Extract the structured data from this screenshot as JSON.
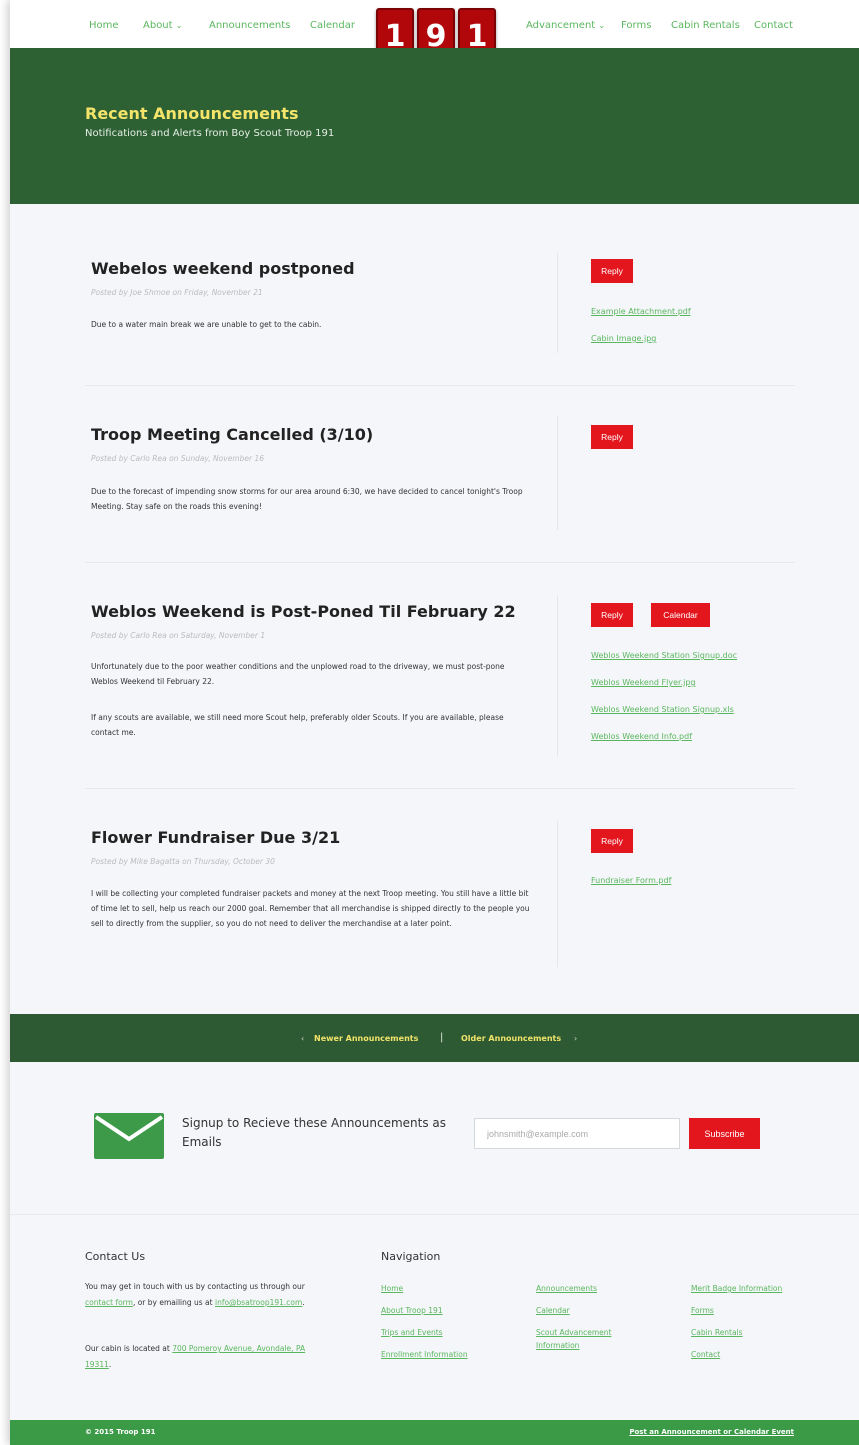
{
  "nav": {
    "home": "Home",
    "about": "About",
    "announcements": "Announcements",
    "calendar": "Calendar",
    "advancement": "Advancement",
    "forms": "Forms",
    "cabin_rentals": "Cabin Rentals",
    "contact": "Contact",
    "logo_digits": [
      "1",
      "9",
      "1"
    ]
  },
  "hero": {
    "title": "Recent Announcements",
    "subtitle": "Notifications and Alerts from Boy Scout Troop 191"
  },
  "posts": [
    {
      "title": "Webelos weekend postponed",
      "meta": "Posted by Joe Shmoe on Friday, November 21",
      "body": "Due to a water main break we are unable to get to the cabin.",
      "reply": "Reply",
      "attachments": [
        "Example Attachment.pdf",
        "Cabin Image.jpg"
      ]
    },
    {
      "title": "Troop Meeting Cancelled (3/10)",
      "meta": "Posted by Carlo Rea on Sunday, November 16",
      "body": "Due to the forecast of impending snow storms for our area around 6:30, we have decided to cancel tonight's Troop Meeting. Stay safe on the roads this evening!",
      "reply": "Reply"
    },
    {
      "title": "Weblos Weekend is Post-Poned Til February 22",
      "meta": "Posted by Carlo Rea on Saturday, November 1",
      "body1": "Unfortunately due to the poor weather conditions and the unplowed road to the driveway, we must post-pone Weblos Weekend til February 22.",
      "body2": "If any scouts are available, we still need more Scout help, preferably older Scouts. If you are available, please contact me.",
      "reply": "Reply",
      "calendar": "Calendar",
      "attachments": [
        "Weblos Weekend Station Signup.doc",
        "Weblos Weekend Flyer.jpg",
        "Weblos Weekend Station Signup.xls",
        "Weblos Weekend Info.pdf"
      ]
    },
    {
      "title": "Flower Fundraiser Due 3/21",
      "meta": "Posted by Mike Bagatta on Thursday, October 30",
      "body": "I will be collecting your completed fundraiser packets and money at the next Troop meeting. You still have a little bit of time let to sell, help us reach our 2000 goal. Remember that all merchandise is shipped directly to the people you sell to directly from the supplier, so you do not need to deliver the merchandise at a later point.",
      "reply": "Reply",
      "attachments": [
        "Fundraiser Form.pdf"
      ]
    }
  ],
  "pager": {
    "newer": "Newer Announcements",
    "older": "Older Announcements",
    "separator": "|",
    "left_arrow": "‹",
    "right_arrow": "›"
  },
  "signup": {
    "text": "Signup to Recieve these Announcements as Emails",
    "placeholder": "johnsmith@example.com",
    "button": "Subscribe"
  },
  "footer": {
    "contact_heading": "Contact Us",
    "contact_text_1": "You may get in touch with us by contacting us through our ",
    "contact_form_link": "contact form",
    "contact_text_2": ", or by emailing us at ",
    "email_link": "info@bsatroop191.com",
    "contact_text_3": ".",
    "cabin_text": "Our cabin is located at ",
    "address_link": "700 Pomeroy Avenue, Avondale, PA 19311",
    "cabin_text_end": ".",
    "nav_heading": "Navigation",
    "nav_col1": [
      "Home",
      "About Troop 191",
      "Trips and Events",
      "Enrollment Information"
    ],
    "nav_col2": [
      "Announcements",
      "Calendar",
      "Scout Advancement Information"
    ],
    "nav_col3": [
      "Merit Badge Information",
      "Forms",
      "Cabin Rentals",
      "Contact"
    ]
  },
  "bottom": {
    "copyright": "© 2015 Troop 191",
    "post_link": "Post an Announcement or Calendar Event"
  },
  "colors": {
    "accent_green": "#5bb75f",
    "hero_green": "#2d6133",
    "title_yellow": "#f4e46a",
    "button_red": "#e3161e"
  }
}
